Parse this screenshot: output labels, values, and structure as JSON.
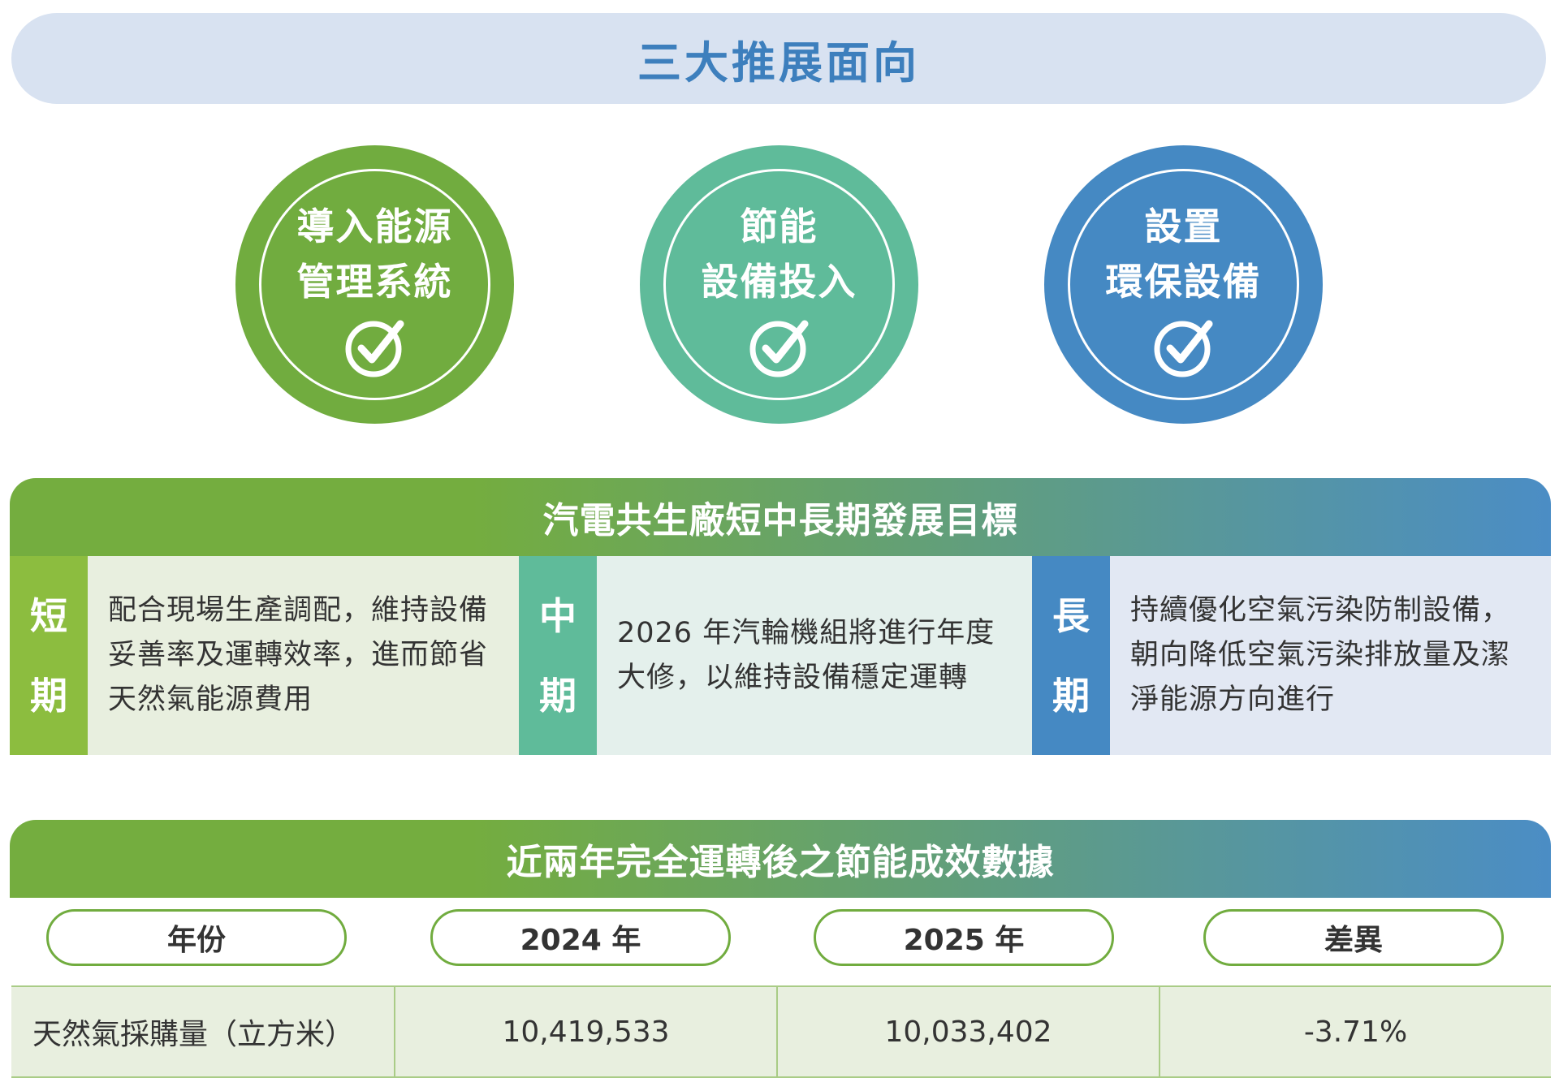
{
  "title": "三大推展面向",
  "circles": [
    {
      "line1": "導入能源",
      "line2": "管理系統",
      "color": "#71ac3f"
    },
    {
      "line1": "節能",
      "line2": "設備投入",
      "color": "#5fbb9a"
    },
    {
      "line1": "設置",
      "line2": "環保設備",
      "color": "#4589c3"
    }
  ],
  "goals": {
    "header": "汽電共生廠短中長期發展目標",
    "short": {
      "label_1": "短",
      "label_2": "期",
      "text": "配合現場生產調配，維持設備妥善率及運轉效率，進而節省天然氣能源費用"
    },
    "mid": {
      "label_1": "中",
      "label_2": "期",
      "text": "2026 年汽輪機組將進行年度大修，以維持設備穩定運轉"
    },
    "long": {
      "label_1": "長",
      "label_2": "期",
      "text": "持續優化空氣污染防制設備，朝向降低空氣污染排放量及潔淨能源方向進行"
    }
  },
  "energy_data": {
    "header": "近兩年完全運轉後之節能成效數據",
    "columns": [
      "年份",
      "2024 年",
      "2025 年",
      "差異"
    ],
    "rows": [
      [
        "天然氣採購量（立方米）",
        "10,419,533",
        "10,033,402",
        "-3.71%"
      ]
    ]
  },
  "icons": {
    "check": "check-circle-icon"
  },
  "colors": {
    "green": "#71ac3f",
    "teal": "#5fbb9a",
    "blue": "#4589c3",
    "title_text": "#3d7fbd"
  }
}
